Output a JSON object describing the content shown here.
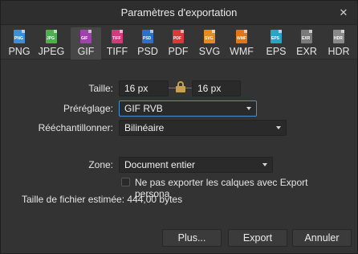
{
  "dialog": {
    "title": "Paramètres d'exportation",
    "close_glyph": "✕"
  },
  "formats": [
    {
      "label": "PNG",
      "color": "#3a8fd6",
      "tag": "PNG",
      "active": false
    },
    {
      "label": "JPEG",
      "color": "#4caf50",
      "tag": "JPG",
      "active": false
    },
    {
      "label": "GIF",
      "color": "#a33fb0",
      "tag": "GIF",
      "active": true
    },
    {
      "label": "TIFF",
      "color": "#d6397a",
      "tag": "TIFF",
      "active": false
    },
    {
      "label": "PSD",
      "color": "#2e6fc9",
      "tag": "PSD",
      "active": false
    },
    {
      "label": "PDF",
      "color": "#d63a3a",
      "tag": "PDF",
      "active": false
    },
    {
      "label": "SVG",
      "color": "#e58a1c",
      "tag": "SVG",
      "active": false
    },
    {
      "label": "WMF",
      "color": "#e0751b",
      "tag": "WMF",
      "active": false
    },
    {
      "label": "EPS",
      "color": "#2aa3c9",
      "tag": "EPS",
      "active": false
    },
    {
      "label": "EXR",
      "color": "#7a7a7a",
      "tag": "EXR",
      "active": false
    },
    {
      "label": "HDR",
      "color": "#8a8a8a",
      "tag": "HDR",
      "active": false
    }
  ],
  "size": {
    "label": "Taille:",
    "width": "16 px",
    "height": "16 px"
  },
  "preset": {
    "label": "Préréglage:",
    "value": "GIF RVB"
  },
  "resample": {
    "label": "Rééchantillonner:",
    "value": "Bilinéaire"
  },
  "zone": {
    "label": "Zone:",
    "value": "Document entier"
  },
  "option_no_layers": "Ne pas exporter les calques avec Export persona",
  "estimated_size": "Taille de fichier estimée: 444,00 bytes",
  "buttons": {
    "more": "Plus...",
    "export": "Export",
    "cancel": "Annuler"
  }
}
